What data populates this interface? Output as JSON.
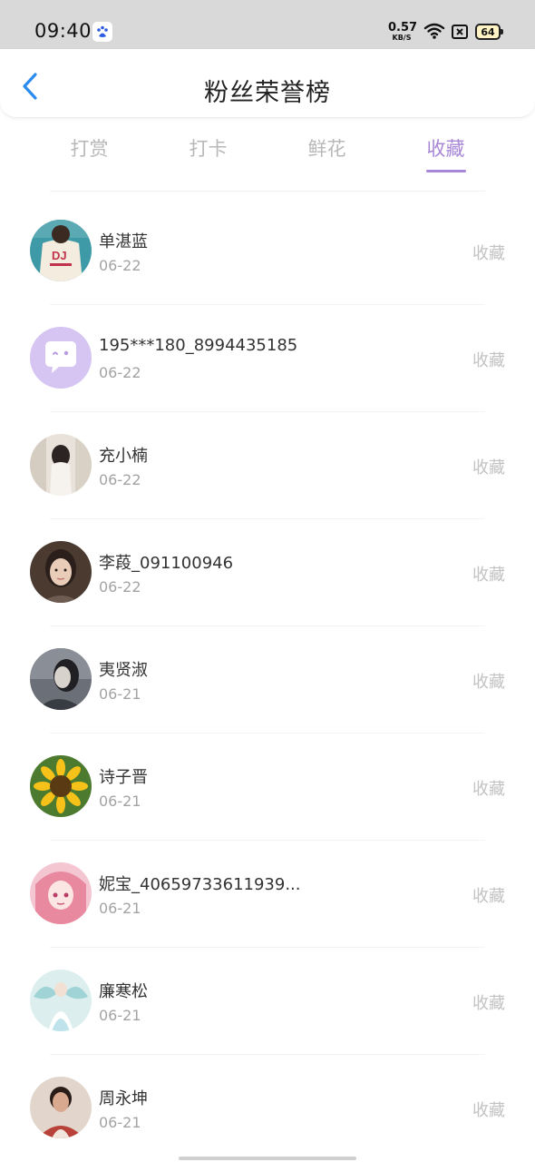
{
  "status_bar": {
    "time": "09:40",
    "net_speed_value": "0.57",
    "net_speed_unit": "KB/S",
    "battery": "64"
  },
  "header": {
    "title": "粉丝荣誉榜",
    "back_icon": "chevron-left-icon",
    "accent_color": "#2a8cf0"
  },
  "tabs": [
    {
      "label": "打赏",
      "active": false
    },
    {
      "label": "打卡",
      "active": false
    },
    {
      "label": "鲜花",
      "active": false
    },
    {
      "label": "收藏",
      "active": true
    }
  ],
  "tab_active_color": "#a887d6",
  "fans": [
    {
      "name": "单湛蓝",
      "date": "06-22",
      "action": "收藏",
      "avatar": "photo-dj-shirt"
    },
    {
      "name": "195***180_8994435185",
      "date": "06-22",
      "action": "收藏",
      "avatar": "default-chat-bubble"
    },
    {
      "name": "充小楠",
      "date": "06-22",
      "action": "收藏",
      "avatar": "photo-girl-back"
    },
    {
      "name": "李葮_091100946",
      "date": "06-22",
      "action": "收藏",
      "avatar": "photo-girl-face"
    },
    {
      "name": "夷贤淑",
      "date": "06-21",
      "action": "收藏",
      "avatar": "photo-girl-gray"
    },
    {
      "name": "诗子晋",
      "date": "06-21",
      "action": "收藏",
      "avatar": "photo-sunflower"
    },
    {
      "name": "妮宝_40659733611939...",
      "date": "06-21",
      "action": "收藏",
      "avatar": "anime-pink-girl"
    },
    {
      "name": "廉寒松",
      "date": "06-21",
      "action": "收藏",
      "avatar": "anime-fairy"
    },
    {
      "name": "周永坤",
      "date": "06-21",
      "action": "收藏",
      "avatar": "photo-woman-portrait"
    }
  ]
}
